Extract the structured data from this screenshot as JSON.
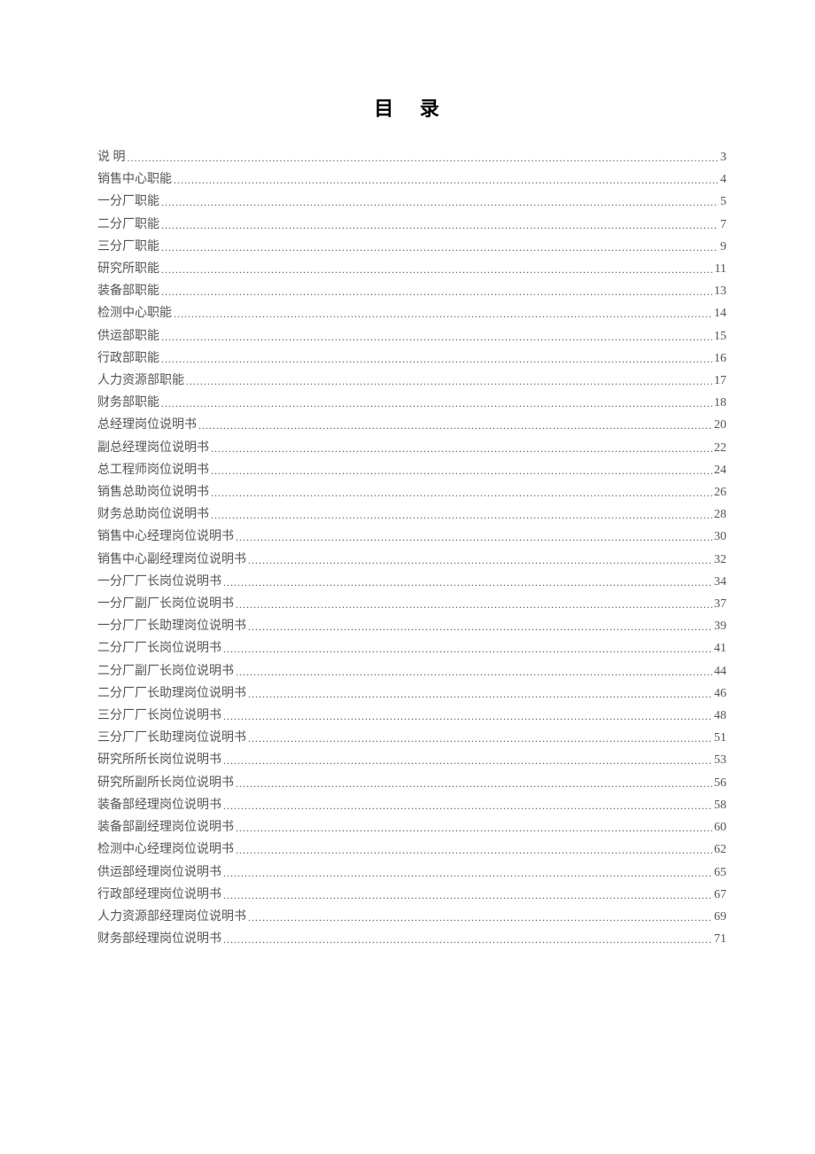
{
  "title": "目 录",
  "entries": [
    {
      "label": "说    明",
      "page": "3"
    },
    {
      "label": "销售中心职能",
      "page": "4"
    },
    {
      "label": "一分厂职能",
      "page": "5"
    },
    {
      "label": "二分厂职能",
      "page": "7"
    },
    {
      "label": "三分厂职能",
      "page": "9"
    },
    {
      "label": "研究所职能",
      "page": "11"
    },
    {
      "label": "装备部职能",
      "page": "13"
    },
    {
      "label": "检测中心职能",
      "page": "14"
    },
    {
      "label": "供运部职能",
      "page": "15"
    },
    {
      "label": "行政部职能",
      "page": "16"
    },
    {
      "label": "人力资源部职能",
      "page": "17"
    },
    {
      "label": "财务部职能",
      "page": "18"
    },
    {
      "label": "总经理岗位说明书",
      "page": "20"
    },
    {
      "label": "副总经理岗位说明书",
      "page": "22"
    },
    {
      "label": "总工程师岗位说明书",
      "page": "24"
    },
    {
      "label": "销售总助岗位说明书",
      "page": "26"
    },
    {
      "label": "财务总助岗位说明书",
      "page": "28"
    },
    {
      "label": "销售中心经理岗位说明书",
      "page": "30"
    },
    {
      "label": "销售中心副经理岗位说明书",
      "page": "32"
    },
    {
      "label": "一分厂厂长岗位说明书",
      "page": "34"
    },
    {
      "label": "一分厂副厂长岗位说明书",
      "page": "37"
    },
    {
      "label": "一分厂厂长助理岗位说明书",
      "page": "39"
    },
    {
      "label": "二分厂厂长岗位说明书",
      "page": "41"
    },
    {
      "label": "二分厂副厂长岗位说明书",
      "page": "44"
    },
    {
      "label": "二分厂厂长助理岗位说明书",
      "page": "46"
    },
    {
      "label": "三分厂厂长岗位说明书",
      "page": "48"
    },
    {
      "label": "三分厂厂长助理岗位说明书",
      "page": "51"
    },
    {
      "label": "研究所所长岗位说明书",
      "page": "53"
    },
    {
      "label": "研究所副所长岗位说明书",
      "page": "56"
    },
    {
      "label": "装备部经理岗位说明书",
      "page": "58"
    },
    {
      "label": "装备部副经理岗位说明书",
      "page": "60"
    },
    {
      "label": "检测中心经理岗位说明书",
      "page": "62"
    },
    {
      "label": "供运部经理岗位说明书",
      "page": "65"
    },
    {
      "label": "行政部经理岗位说明书",
      "page": "67"
    },
    {
      "label": "人力资源部经理岗位说明书",
      "page": "69"
    },
    {
      "label": "财务部经理岗位说明书",
      "page": "71"
    }
  ]
}
